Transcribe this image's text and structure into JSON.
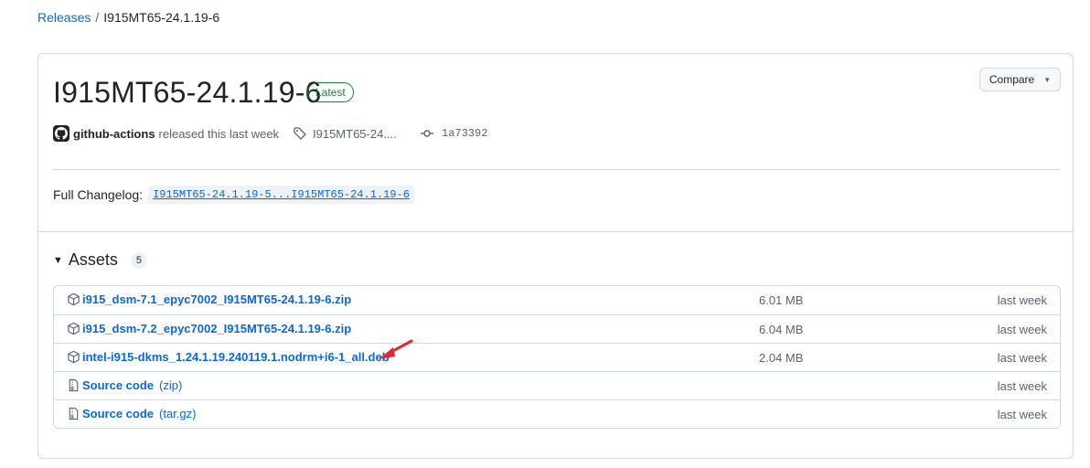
{
  "breadcrumb": {
    "releases": "Releases",
    "sep": "/",
    "current": "I915MT65-24.1.19-6"
  },
  "release": {
    "title": "I915MT65-24.1.19-6",
    "badge": "Latest",
    "compare_label": "Compare",
    "author": "github-actions",
    "released_text": "released this last week",
    "tag": "I915MT65-24....",
    "commit": "1a73392",
    "changelog_label": "Full Changelog:",
    "changelog_link": "I915MT65-24.1.19-5...I915MT65-24.1.19-6"
  },
  "assets": {
    "title": "Assets",
    "count": "5",
    "items": [
      {
        "icon": "package-icon",
        "name": "i915_dsm-7.1_epyc7002_I915MT65-24.1.19-6.zip",
        "ext": "",
        "size": "6.01 MB",
        "date": "last week"
      },
      {
        "icon": "package-icon",
        "name": "i915_dsm-7.2_epyc7002_I915MT65-24.1.19-6.zip",
        "ext": "",
        "size": "6.04 MB",
        "date": "last week"
      },
      {
        "icon": "package-icon",
        "name": "intel-i915-dkms_1.24.1.19.240119.1.nodrm+i6-1_all.deb",
        "ext": "",
        "size": "2.04 MB",
        "date": "last week"
      },
      {
        "icon": "file-zip-icon",
        "name": "Source code",
        "ext": "(zip)",
        "size": "",
        "date": "last week"
      },
      {
        "icon": "file-zip-icon",
        "name": "Source code",
        "ext": "(tar.gz)",
        "size": "",
        "date": "last week"
      }
    ]
  },
  "colors": {
    "link": "#0969da",
    "badge_green": "#1a7f37",
    "arrow_red": "#e5262c",
    "border": "#d1d9e0"
  }
}
